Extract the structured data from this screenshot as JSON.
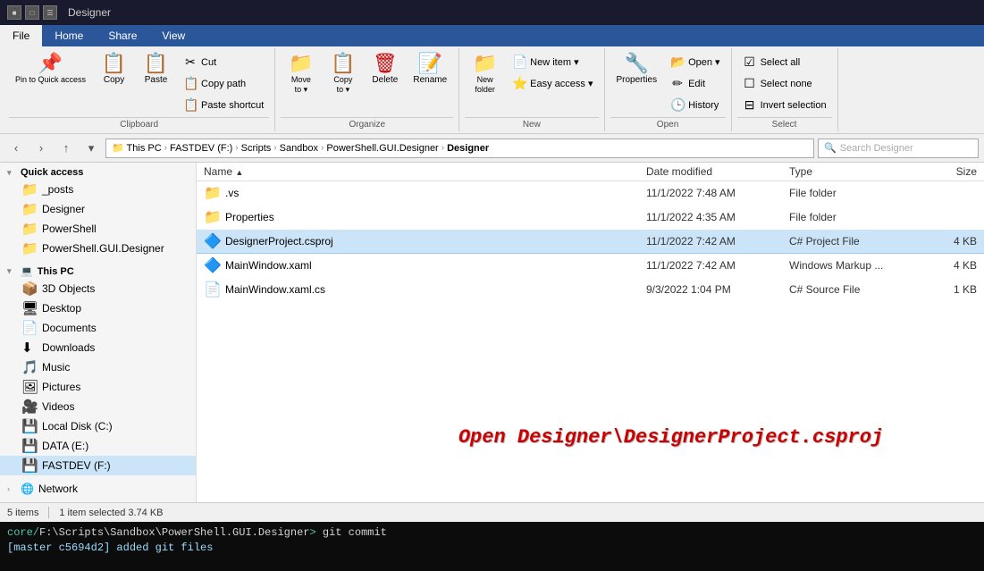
{
  "titleBar": {
    "title": "Designer",
    "icons": [
      "■",
      "□",
      "✕"
    ]
  },
  "ribbonTabs": [
    {
      "label": "File",
      "active": true
    },
    {
      "label": "Home",
      "active": false
    },
    {
      "label": "Share",
      "active": false
    },
    {
      "label": "View",
      "active": false
    }
  ],
  "ribbon": {
    "clipboard": {
      "label": "Clipboard",
      "pinLabel": "Pin to Quick\naccess",
      "copyLabel": "Copy",
      "cutLabel": "Cut",
      "copyPathLabel": "Copy path",
      "pasteShortcutLabel": "Paste shortcut",
      "pasteLabel": "Paste"
    },
    "organize": {
      "label": "Organize",
      "moveLabel": "Move\nto",
      "copyLabel": "Copy\nto",
      "deleteLabel": "Delete",
      "renameLabel": "Rename"
    },
    "new": {
      "label": "New",
      "newFolderLabel": "New\nfolder",
      "newItemLabel": "New item ▾",
      "easyAccessLabel": "Easy access ▾"
    },
    "open": {
      "label": "Open",
      "propertiesLabel": "Properties",
      "openLabel": "Open ▾",
      "editLabel": "Edit",
      "historyLabel": "History"
    },
    "select": {
      "label": "Select",
      "selectAllLabel": "Select all",
      "selectNoneLabel": "Select none",
      "invertSelectionLabel": "Invert selection"
    }
  },
  "addressBar": {
    "breadcrumbs": [
      "This PC",
      "FASTDEV (F:)",
      "Scripts",
      "Sandbox",
      "PowerShell.GUI.Designer",
      "Designer"
    ],
    "searchPlaceholder": "Search Designer"
  },
  "sidebar": {
    "quickAccess": [
      {
        "name": "_posts",
        "type": "folder",
        "indent": 1
      },
      {
        "name": "Designer",
        "type": "folder",
        "indent": 1
      },
      {
        "name": "PowerShell",
        "type": "folder",
        "indent": 1
      },
      {
        "name": "PowerShell.GUI.Designer",
        "type": "folder",
        "indent": 1
      }
    ],
    "thisPC": {
      "label": "This PC",
      "items": [
        {
          "name": "3D Objects",
          "type": "folder"
        },
        {
          "name": "Desktop",
          "type": "folder"
        },
        {
          "name": "Documents",
          "type": "folder"
        },
        {
          "name": "Downloads",
          "type": "folder"
        },
        {
          "name": "Music",
          "type": "music"
        },
        {
          "name": "Pictures",
          "type": "pictures"
        },
        {
          "name": "Videos",
          "type": "videos"
        },
        {
          "name": "Local Disk (C:)",
          "type": "drive"
        },
        {
          "name": "DATA (E:)",
          "type": "drive"
        },
        {
          "name": "FASTDEV (F:)",
          "type": "drive",
          "selected": true
        }
      ]
    },
    "network": {
      "label": "Network"
    }
  },
  "fileList": {
    "columns": {
      "name": "Name",
      "dateModified": "Date modified",
      "type": "Type",
      "size": "Size"
    },
    "files": [
      {
        "name": ".vs",
        "type": "File folder",
        "dateModified": "11/1/2022 7:48 AM",
        "size": "",
        "icon": "📁",
        "isFolder": true
      },
      {
        "name": "Properties",
        "type": "File folder",
        "dateModified": "11/1/2022 4:35 AM",
        "size": "",
        "icon": "📁",
        "isFolder": true
      },
      {
        "name": "DesignerProject.csproj",
        "type": "C# Project File",
        "dateModified": "11/1/2022 7:42 AM",
        "size": "4 KB",
        "icon": "🔷",
        "selected": true
      },
      {
        "name": "MainWindow.xaml",
        "type": "Windows Markup ...",
        "dateModified": "11/1/2022 7:42 AM",
        "size": "4 KB",
        "icon": "🔷"
      },
      {
        "name": "MainWindow.xaml.cs",
        "type": "C# Source File",
        "dateModified": "9/3/2022 1:04 PM",
        "size": "1 KB",
        "icon": "📄"
      }
    ]
  },
  "overlayText": "Open Designer\\DesignerProject.csproj",
  "statusBar": {
    "itemCount": "5 items",
    "selectedInfo": "1 item selected  3.74 KB"
  },
  "terminal": {
    "line1": "core/F:\\Scripts\\Sandbox\\PowerShell.GUI.Designer> git commit",
    "line2": "[master c5694d2] added git files"
  }
}
